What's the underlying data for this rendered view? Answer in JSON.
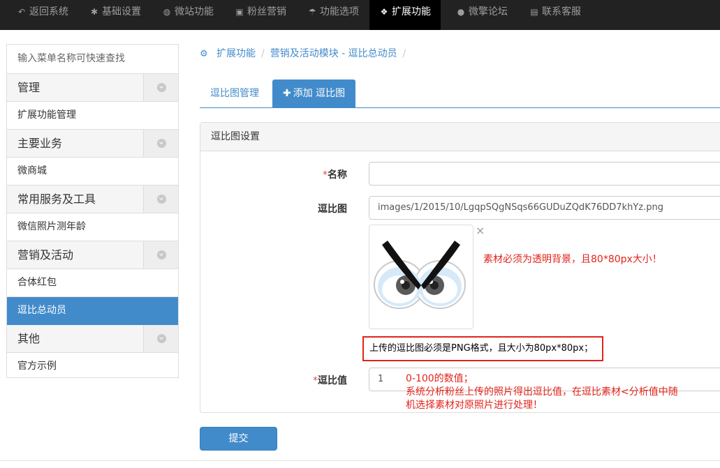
{
  "topnav": {
    "items": [
      {
        "label": "返回系统",
        "icon": "reply-icon"
      },
      {
        "label": "基础设置",
        "icon": "gear-icon"
      },
      {
        "label": "微站功能",
        "icon": "globe-icon"
      },
      {
        "label": "粉丝营销",
        "icon": "gift-icon"
      },
      {
        "label": "功能选项",
        "icon": "umbrella-icon"
      },
      {
        "label": "扩展功能",
        "icon": "cubes-icon",
        "active": true
      },
      {
        "label": "微擎论坛",
        "icon": "comment-icon"
      },
      {
        "label": "联系客服",
        "icon": "briefcase-icon"
      }
    ]
  },
  "sidebar": {
    "search_placeholder": "输入菜单名称可快速查找",
    "groups": [
      {
        "title": "管理",
        "items": [
          "扩展功能管理"
        ]
      },
      {
        "title": "主要业务",
        "items": [
          "微商城"
        ]
      },
      {
        "title": "常用服务及工具",
        "items": [
          "微信照片测年龄"
        ]
      },
      {
        "title": "营销及活动",
        "items": [
          "合体红包",
          "逗比总动员"
        ]
      },
      {
        "title": "其他",
        "items": [
          "官方示例"
        ]
      }
    ],
    "active_item": "逗比总动员"
  },
  "breadcrumb": {
    "items": [
      "扩展功能",
      "营销及活动模块 - 逗比总动员"
    ],
    "separator": "/"
  },
  "tabs": [
    {
      "label": "逗比图管理",
      "active": false
    },
    {
      "label": "添加 逗比图",
      "active": true,
      "prefix": "✚"
    }
  ],
  "panel": {
    "title": "逗比图设置",
    "fields": {
      "name": {
        "required_mark": "*",
        "label": "名称",
        "value": ""
      },
      "image": {
        "label": "逗比图",
        "value": "images/1/2015/10/LgqpSQgNSqs66GUDuZQdK76DD7khYz.png",
        "remove_glyph": "×",
        "note": "素材必须为透明背景，且80*80px大小！",
        "boxed_note": "上传的逗比图必须是PNG格式，且大小为80px*80px；"
      },
      "value": {
        "required_mark": "*",
        "label": "逗比值",
        "value": "1",
        "note_line1": "0-100的数值；",
        "note_line2": "系统分析粉丝上传的照片得出逗比值，在逗比素材<分析值中随",
        "note_line3": "机选择素材对原照片进行处理！"
      }
    }
  },
  "submit_label": "提交",
  "colors": {
    "nav_bg": "#222222",
    "primary": "#428bca",
    "annotation_red": "#e2231a"
  }
}
